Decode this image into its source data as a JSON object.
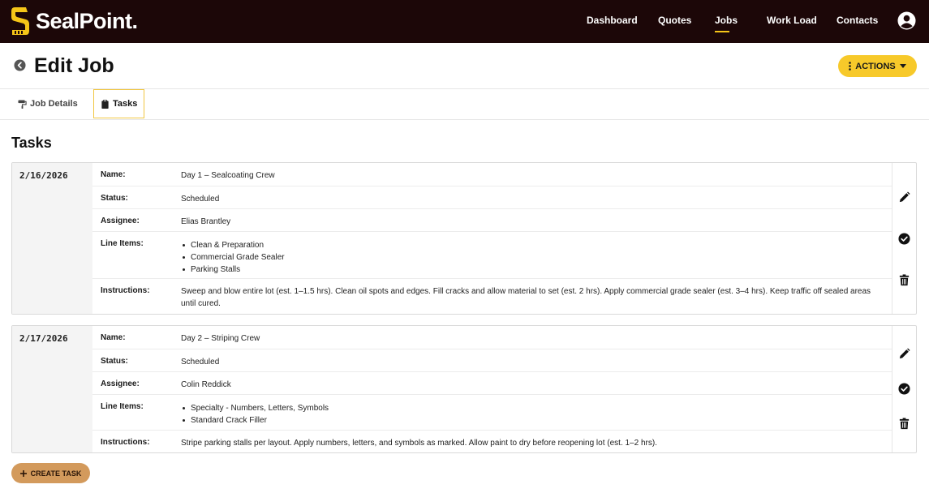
{
  "brand": {
    "name": "SealPoint",
    "accent": "#f5c518",
    "navbar_bg": "#1c0708"
  },
  "nav": {
    "items": [
      {
        "label": "Dashboard",
        "active": false
      },
      {
        "label": "Quotes",
        "active": false
      },
      {
        "label": "Jobs",
        "active": true
      },
      {
        "label": "Work Load",
        "active": false
      },
      {
        "label": "Contacts",
        "active": false
      }
    ],
    "user_icon": "user-circle-icon"
  },
  "page": {
    "title": "Edit Job",
    "back_icon": "arrow-left-circle-icon",
    "actions_label": "ACTIONS"
  },
  "tabs": [
    {
      "label": "Job Details",
      "icon": "paint-roller-icon",
      "active": false
    },
    {
      "label": "Tasks",
      "icon": "clipboard-icon",
      "active": true
    }
  ],
  "section": {
    "title": "Tasks"
  },
  "labels": {
    "name": "Name:",
    "status": "Status:",
    "assignee": "Assignee:",
    "line_items": "Line Items:",
    "instructions": "Instructions:"
  },
  "tasks": [
    {
      "date": "2/16/2026",
      "name": "Day 1 – Sealcoating Crew",
      "status": "Scheduled",
      "assignee": "Elias Brantley",
      "line_items": [
        "Clean & Preparation",
        "Commercial Grade Sealer",
        "Parking Stalls"
      ],
      "instructions": "Sweep and blow entire lot (est. 1–1.5 hrs). Clean oil spots and edges. Fill cracks and allow material to set (est. 2 hrs). Apply commercial grade sealer (est. 3–4 hrs). Keep traffic off sealed areas until cured."
    },
    {
      "date": "2/17/2026",
      "name": "Day 2 – Striping Crew",
      "status": "Scheduled",
      "assignee": "Colin Reddick",
      "line_items": [
        "Specialty - Numbers, Letters, Symbols",
        "Standard Crack Filler"
      ],
      "instructions": "Stripe parking stalls per layout. Apply numbers, letters, and symbols as marked. Allow paint to dry before reopening lot (est. 1–2 hrs)."
    }
  ],
  "task_action_icons": [
    "pencil-icon",
    "check-circle-icon",
    "trash-icon"
  ],
  "create_task_label": "CREATE TASK"
}
